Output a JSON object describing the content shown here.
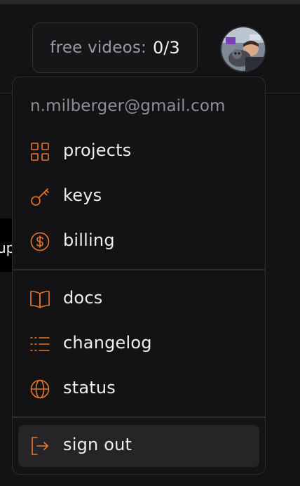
{
  "header": {
    "free_videos_label": "free videos:",
    "free_videos_count": "0/3",
    "avatar_icon": "user-avatar"
  },
  "background": {
    "partial_tab_text": "up"
  },
  "menu": {
    "email": "n.milberger@gmail.com",
    "accent_color": "#e8762c",
    "group1": [
      {
        "label": "projects",
        "icon": "grid-icon"
      },
      {
        "label": "keys",
        "icon": "key-icon"
      },
      {
        "label": "billing",
        "icon": "dollar-circle-icon"
      }
    ],
    "group2": [
      {
        "label": "docs",
        "icon": "book-icon"
      },
      {
        "label": "changelog",
        "icon": "list-icon"
      },
      {
        "label": "status",
        "icon": "globe-icon"
      }
    ],
    "signout": {
      "label": "sign out",
      "icon": "sign-out-icon"
    }
  }
}
